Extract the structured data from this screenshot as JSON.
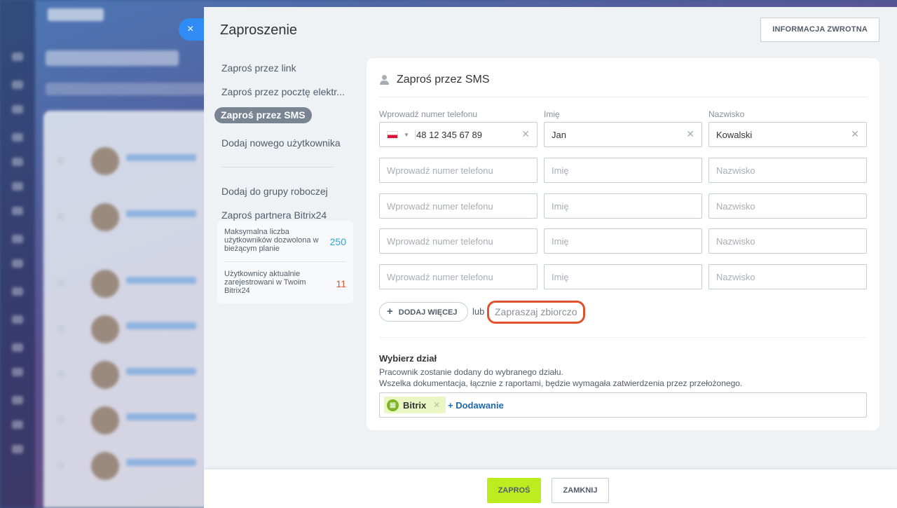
{
  "window": {
    "title": "Zaproszenie",
    "feedback_label": "INFORMACJA ZWROTNA",
    "close_glyph": "×"
  },
  "menu": {
    "items": [
      {
        "label": "Zaproś przez link"
      },
      {
        "label": "Zaproś przez pocztę elektr..."
      },
      {
        "label": "Zaproś przez SMS",
        "active": true
      },
      {
        "label": "Dodaj nowego użytkownika"
      }
    ],
    "items2": [
      {
        "label": "Dodaj do grupy roboczej"
      },
      {
        "label": "Zaproś partnera Bitrix24"
      }
    ]
  },
  "limits": {
    "max_label": "Maksymalna liczba użytkowników dozwolona w bieżącym planie",
    "max_value": "250",
    "max_color": "#2fa6d3",
    "current_label": "Użytkownicy aktualnie zarejestrowani w Twoim Bitrix24",
    "current_value": "11",
    "current_color": "#e0522d"
  },
  "form": {
    "heading": "Zaproś przez SMS",
    "col_phone": "Wprowadź numer telefonu",
    "col_first": "Imię",
    "col_last": "Nazwisko",
    "row1": {
      "phone": "48 12 345 67 89",
      "first": "Jan",
      "last": "Kowalski"
    },
    "placeholders": {
      "phone": "Wprowadź numer telefonu",
      "first": "Imię",
      "last": "Nazwisko"
    },
    "add_more": "DODAJ WIĘCEJ",
    "or": "lub",
    "mass_invite": "Zapraszaj zbiorczo"
  },
  "department": {
    "title": "Wybierz dział",
    "desc1": "Pracownik zostanie dodany do wybranego działu.",
    "desc2": "Wszelka dokumentacja, łącznie z raportami, będzie wymagała zatwierdzenia przez przełożonego.",
    "tag": "Bitrix",
    "add": "+ Dodawanie"
  },
  "footer": {
    "invite": "ZAPROŚ",
    "close": "ZAMKNIJ"
  }
}
